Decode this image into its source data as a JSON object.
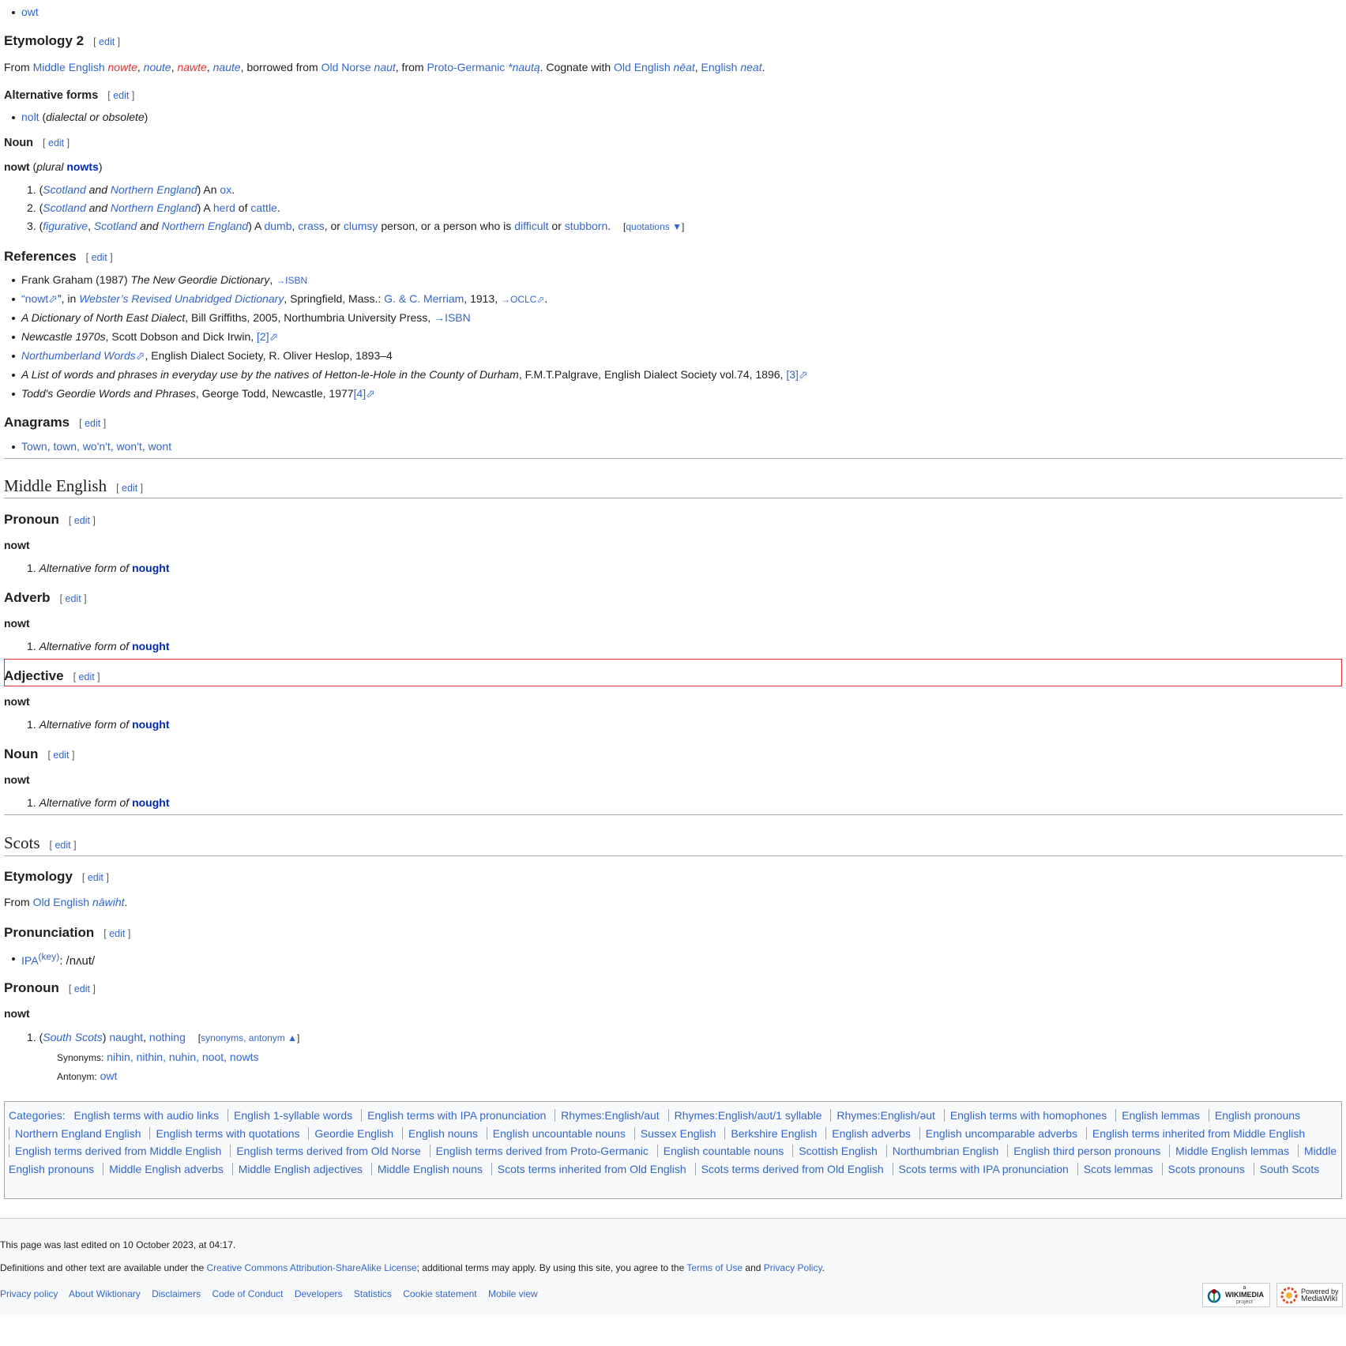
{
  "top_item": "owt",
  "etym2": {
    "heading": "Etymology 2",
    "edit": "edit",
    "t_from": "From ",
    "me": "Middle English",
    "f1": "nowte",
    "f2": "noute",
    "f3": "nawte",
    "f4": "naute",
    "t_borrowed": ", borrowed from ",
    "on": "Old Norse",
    "on_word": "naut",
    "t_from2": ", from ",
    "pg": "Proto-Germanic",
    "pg_word": "*nautą",
    "t_cognate": ". Cognate with ",
    "oe": "Old English",
    "oe_word": "nēat",
    "en": "English",
    "en_word": "neat"
  },
  "alt_forms": {
    "heading": "Alternative forms",
    "item_link": "nolt",
    "item_note": "dialectal or obsolete"
  },
  "noun1": {
    "heading": "Noun",
    "head": "nowt",
    "plural_label": "plural",
    "plural_word": "nowts",
    "senses": [
      {
        "n": "1.",
        "l1": "Scotland",
        "and": "and",
        "l2": "Northern England",
        "text": "An",
        "link": "ox"
      },
      {
        "n": "2.",
        "l1": "Scotland",
        "and": "and",
        "l2": "Northern England",
        "text": "A",
        "link": "herd",
        "of": "of",
        "link2": "cattle"
      },
      {
        "n": "3.",
        "l0": "figurative",
        "l1": "Scotland",
        "and": "and",
        "l2": "Northern England",
        "a": "A",
        "w1": "dumb",
        "w2": "crass",
        "or": "or",
        "w3": "clumsy",
        "mid": "person, or a person who is",
        "w4": "difficult",
        "w5": "stubborn",
        "quot": "quotations ▼"
      }
    ]
  },
  "refs": {
    "heading": "References",
    "items": [
      {
        "pre": "Frank Graham (1987) ",
        "it": "The New Geordie Dictionary",
        "post": ", ",
        "link": "→ISBN"
      },
      {
        "q1": "“",
        "link": "nowt",
        "q2": "”, in ",
        "it": "Webster’s Revised Unabridged Dictionary",
        "mid": ", Springfield, Mass.: ",
        "link2": "G. & C. Merriam",
        "post": ", 1913, ",
        "link3": "→OCLC"
      },
      {
        "it": "A Dictionary of North East Dialect",
        "post": ", Bill Griffiths, 2005, Northumbria University Press, ",
        "link": "→ISBN"
      },
      {
        "it": "Newcastle 1970s",
        "post": ", Scott Dobson and Dick Irwin, ",
        "link": "[2]"
      },
      {
        "link": "Northumberland Words",
        "post": ", English Dialect Society, R. Oliver Heslop, 1893–4"
      },
      {
        "it": "A List of words and phrases in everyday use by the natives of Hetton-le-Hole in the County of Durham",
        "post": ", F.M.T.Palgrave, English Dialect Society vol.74, 1896, ",
        "link": "[3]"
      },
      {
        "it": "Todd's Geordie Words and Phrases",
        "post": ", George Todd, Newcastle, 1977",
        "link": "[4]"
      }
    ]
  },
  "anagrams": {
    "heading": "Anagrams",
    "items": "Town, town, wo'n't, won't, wont"
  },
  "me_section": {
    "heading": "Middle English",
    "pronoun": "Pronoun",
    "adverb": "Adverb",
    "adjective": "Adjective",
    "noun": "Noun",
    "head": "nowt",
    "n1": "1.",
    "alt": "Alternative form of",
    "target": "nought"
  },
  "scots": {
    "heading": "Scots",
    "etym": "Etymology",
    "etym_from": "From ",
    "etym_link": "Old English",
    "etym_word": "nāwiht",
    "pron": "Pronunciation",
    "ipa": "IPA",
    "key": "(key)",
    "ipa_val": ": /nʌut/",
    "pronoun": "Pronoun",
    "head": "nowt",
    "sense_n": "1.",
    "sense_label": "South Scots",
    "sense_l1": "naught",
    "sense_l2": "nothing",
    "syn_toggle": "synonyms, antonym ▲",
    "syn_label": "Synonyms:",
    "syn": "nihin, nithin, nuhin, noot, nowts",
    "ant_label": "Antonym:",
    "ant": "owt"
  },
  "categories": {
    "label": "Categories:",
    "items": [
      "English terms with audio links",
      "English 1-syllable words",
      "English terms with IPA pronunciation",
      "Rhymes:English/aut",
      "Rhymes:English/aʊt/1 syllable",
      "Rhymes:English/əut",
      "English terms with homophones",
      "English lemmas",
      "English pronouns",
      "Northern England English",
      "English terms with quotations",
      "Geordie English",
      "English nouns",
      "English uncountable nouns",
      "Sussex English",
      "Berkshire English",
      "English adverbs",
      "English uncomparable adverbs",
      "English terms inherited from Middle English",
      "English terms derived from Middle English",
      "English terms derived from Old Norse",
      "English terms derived from Proto-Germanic",
      "English countable nouns",
      "Scottish English",
      "Northumbrian English",
      "English third person pronouns",
      "Middle English lemmas",
      "Middle English pronouns",
      "Middle English adverbs",
      "Middle English adjectives",
      "Middle English nouns",
      "Scots terms inherited from Old English",
      "Scots terms derived from Old English",
      "Scots terms with IPA pronunciation",
      "Scots lemmas",
      "Scots pronouns",
      "South Scots"
    ]
  },
  "footer": {
    "edited": "This page was last edited on 10 October 2023, at 04:17.",
    "lic1": "Definitions and other text are available under the ",
    "lic_link": "Creative Commons Attribution-ShareAlike License",
    "lic2": "; additional terms may apply. By using this site, you agree to the ",
    "terms": "Terms of Use",
    "and": " and ",
    "privacy": "Privacy Policy",
    "dot": ".",
    "links": [
      "Privacy policy",
      "About Wiktionary",
      "Disclaimers",
      "Code of Conduct",
      "Developers",
      "Statistics",
      "Cookie statement",
      "Mobile view"
    ],
    "badge1_small": "a",
    "badge1_main": "WIKIMEDIA",
    "badge1_sub": "project",
    "badge2_small": "Powered by",
    "badge2_main": "MediaWiki"
  }
}
